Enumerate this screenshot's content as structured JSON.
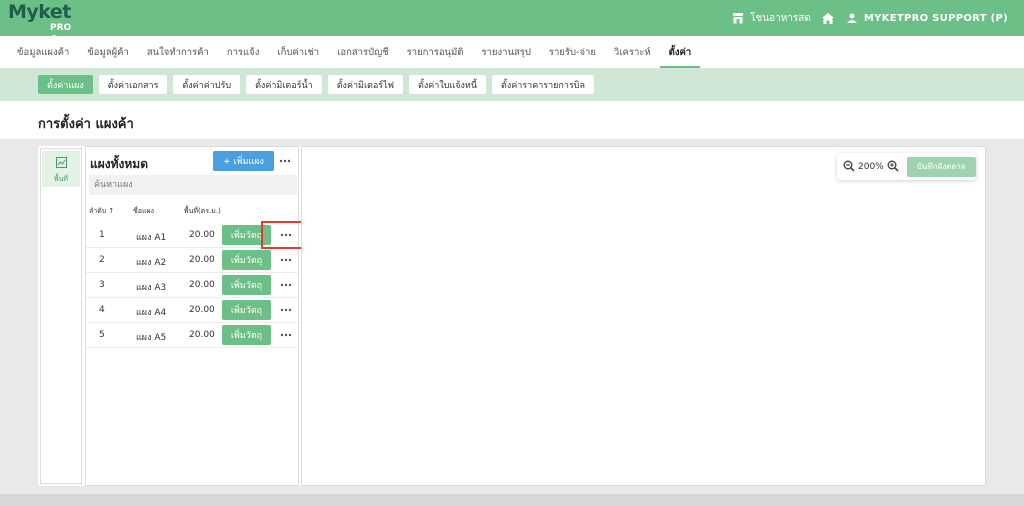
{
  "brand": {
    "logo": "Myket",
    "logo_sub": "PRO"
  },
  "header": {
    "shop_name": "โชนอาหารสด",
    "user_name": "MYKETPRO SUPPORT (P)"
  },
  "main_menu": [
    {
      "label": "ข้อมูลแผงค้า",
      "active": false
    },
    {
      "label": "ข้อมูลผู้ค้า",
      "active": false
    },
    {
      "label": "สนใจทำการค้า",
      "active": false
    },
    {
      "label": "การแจ้ง",
      "active": false
    },
    {
      "label": "เก็บค่าเช่า",
      "active": false
    },
    {
      "label": "เอกสารบัญชี",
      "active": false
    },
    {
      "label": "รายการอนุมัติ",
      "active": false
    },
    {
      "label": "รายงานสรุป",
      "active": false
    },
    {
      "label": "รายรับ-จ่าย",
      "active": false
    },
    {
      "label": "วิเคราะห์",
      "active": false
    },
    {
      "label": "ตั้งค่า",
      "active": true
    }
  ],
  "sub_menu": [
    {
      "label": "ตั้งค่าแผง",
      "active": true
    },
    {
      "label": "ตั้งค่าเอกสาร",
      "active": false
    },
    {
      "label": "ตั้งค่าค่าปรับ",
      "active": false
    },
    {
      "label": "ตั้งค่ามิเตอร์น้ำ",
      "active": false
    },
    {
      "label": "ตั้งค่ามิเตอร์ไฟ",
      "active": false
    },
    {
      "label": "ตั้งค่าใบแจ้งหนี้",
      "active": false
    },
    {
      "label": "ตั้งค่าราคารายการบิล",
      "active": false
    }
  ],
  "page": {
    "title": "การตั้งค่า แผงค้า"
  },
  "tools": {
    "area_label": "พื้นที่"
  },
  "list": {
    "title": "แผงทั้งหมด",
    "add_label": "+ เพิ่มแผง",
    "search_placeholder": "ค้นหาแผง",
    "columns": {
      "order": "ลำดับ ↑",
      "name": "ชื่อแผง",
      "area": "พื้นที่(ตร.ม.)"
    },
    "rows": [
      {
        "order": "1",
        "name": "แผง A1",
        "area": "20.00",
        "action": "เพิ่มวัตถุ"
      },
      {
        "order": "2",
        "name": "แผง A2",
        "area": "20.00",
        "action": "เพิ่มวัตถุ"
      },
      {
        "order": "3",
        "name": "แผง A3",
        "area": "20.00",
        "action": "เพิ่มวัตถุ"
      },
      {
        "order": "4",
        "name": "แผง A4",
        "area": "20.00",
        "action": "เพิ่มวัตถุ"
      },
      {
        "order": "5",
        "name": "แผง A5",
        "area": "20.00",
        "action": "เพิ่มวัตถุ"
      }
    ]
  },
  "canvas": {
    "zoom": "200%",
    "save_label": "บันทึกผังตลาด"
  },
  "colors": {
    "primary": "#6cbf87",
    "sub_bar": "#cfe7d4",
    "blue": "#4a9fe0",
    "highlight": "#e53935"
  },
  "icons": [
    "store-icon",
    "home-icon",
    "user-icon",
    "area-grid-icon",
    "more-dots-icon",
    "zoom-out-icon",
    "zoom-in-icon"
  ]
}
